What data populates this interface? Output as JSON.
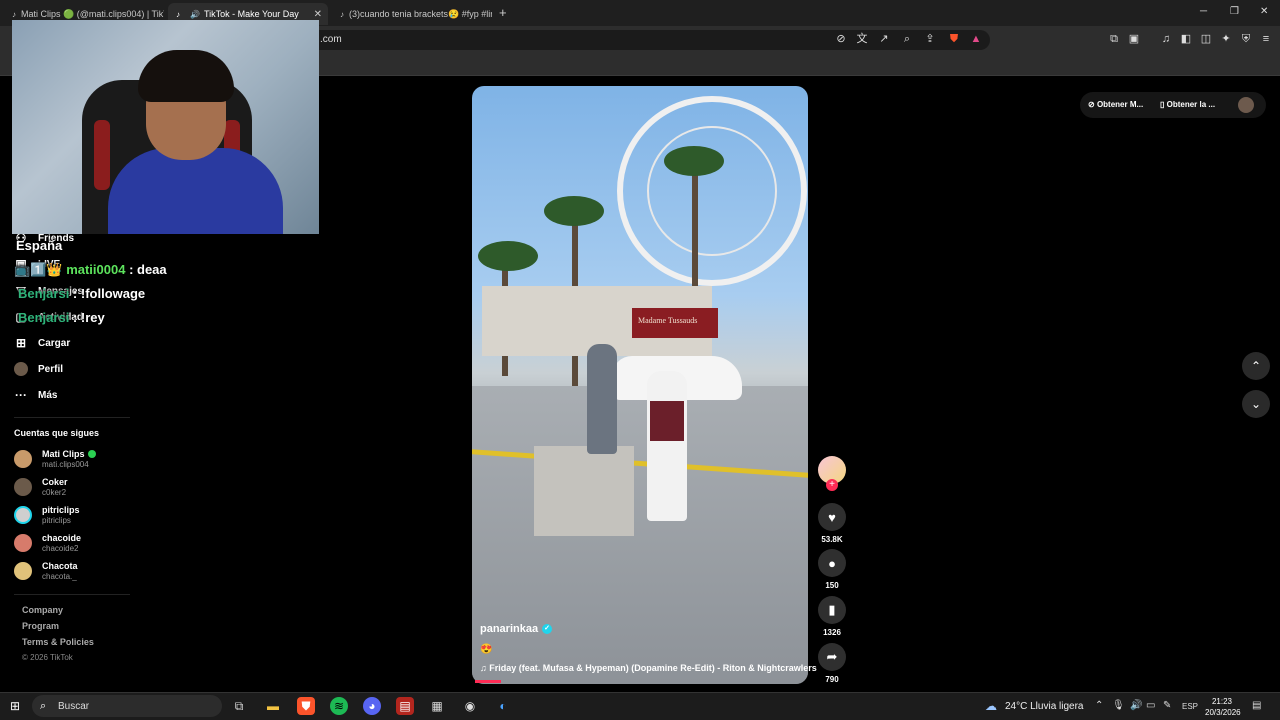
{
  "browser": {
    "tabs": [
      {
        "title": "Mati Clips 🟢 (@mati.clips004) | TikTo",
        "active": false
      },
      {
        "title": "TikTok - Make Your Day",
        "active": true
      },
      {
        "title": "(3)cuando tenia brackets😢 #fyp #lin",
        "active": false
      }
    ],
    "new_tab": "+",
    "url": ".com",
    "window_controls": {
      "minimize": "─",
      "restore": "❐",
      "close": "✕"
    }
  },
  "stream_overlay": {
    "location": "España",
    "chat": [
      {
        "user": "matii0004",
        "message": " : deaa",
        "badges": "📺1️⃣👑"
      },
      {
        "user": "Benjarsi",
        "message": " : !followage"
      },
      {
        "user": "Benjarsi",
        "message": " : !rey"
      }
    ]
  },
  "sidebar": {
    "nav": [
      {
        "label": "Friends",
        "icon": "friends-icon"
      },
      {
        "label": "LIVE",
        "icon": "live-icon"
      },
      {
        "label": "Mensajes",
        "icon": "messages-icon"
      },
      {
        "label": "Actividad",
        "icon": "activity-icon"
      },
      {
        "label": "Cargar",
        "icon": "upload-icon"
      },
      {
        "label": "Perfil",
        "icon": "profile-icon"
      },
      {
        "label": "Más",
        "icon": "more-icon"
      }
    ],
    "following_title": "Cuentas que sigues",
    "following": [
      {
        "name": "Mati Clips",
        "username": "mati.clips004",
        "verified": true,
        "color": "#c89a6a"
      },
      {
        "name": "Coker",
        "username": "c0ker2",
        "verified": false,
        "color": "#6b5a4a"
      },
      {
        "name": "pitriclips",
        "username": "pitriclips",
        "verified": false,
        "color": "#cfcfcf"
      },
      {
        "name": "chacoide",
        "username": "chacoide2",
        "verified": false,
        "color": "#d77b6b"
      },
      {
        "name": "Chacota",
        "username": "chacota._",
        "verified": false,
        "color": "#e0c27a"
      }
    ],
    "footer": [
      "Company",
      "Program",
      "Terms & Policies"
    ],
    "copyright": "© 2026 TikTok"
  },
  "video": {
    "sign": "Madame Tussauds",
    "author": "panarinkaa",
    "caption_emoji": "😍",
    "music": "♫  Friday (feat. Mufasa & Hypeman) (Dopamine Re-Edit) - Riton & Nightcrawlers",
    "likes": "53.8K",
    "comments": "150",
    "saves": "1326",
    "shares": "790",
    "progress": 0.08
  },
  "top_right": {
    "get_app": "Obtener M...",
    "get_app2": "Obtener la ..."
  },
  "taskbar": {
    "search_placeholder": "Buscar",
    "weather": "24°C   Lluvia ligera",
    "language": "ESP",
    "time": "21:23",
    "date": "20/3/2026"
  }
}
